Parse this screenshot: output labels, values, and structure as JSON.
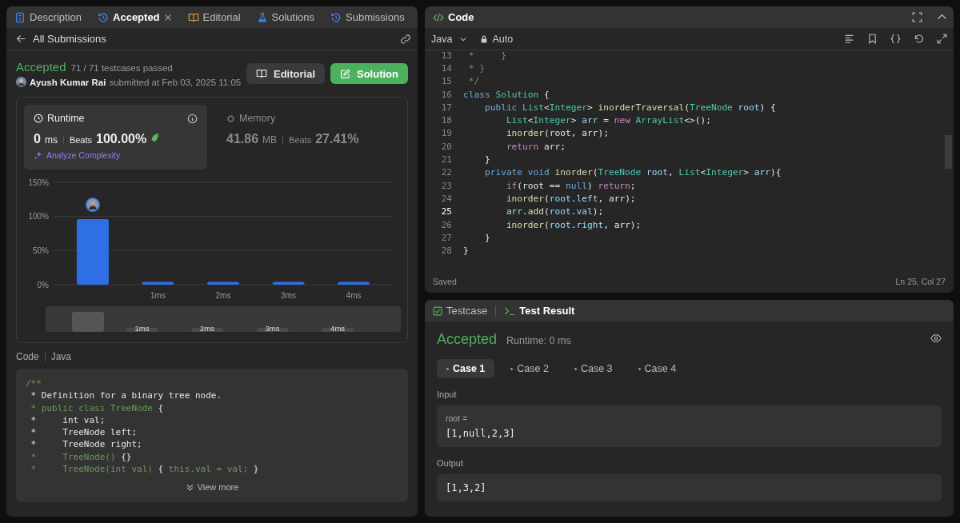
{
  "tabs": [
    {
      "label": "Description",
      "selected": false,
      "closable": false
    },
    {
      "label": "Accepted",
      "selected": true,
      "closable": true
    },
    {
      "label": "Editorial",
      "selected": false,
      "closable": false
    },
    {
      "label": "Solutions",
      "selected": false,
      "closable": false
    },
    {
      "label": "Submissions",
      "selected": false,
      "closable": false
    }
  ],
  "back_link": "All Submissions",
  "submission": {
    "status": "Accepted",
    "testcases": "71 / 71 testcases passed",
    "author": "Ayush Kumar Rai",
    "submitted": "submitted at Feb 03, 2025 11:05",
    "buttons": [
      {
        "label": "Editorial",
        "kind": "secondary"
      },
      {
        "label": "Solution",
        "kind": "primary"
      }
    ]
  },
  "stats": [
    {
      "title": "Runtime",
      "value": "0",
      "unit": "ms",
      "beats_label": "Beats",
      "beats": "100.00%",
      "selected": true,
      "action": "Analyze Complexity"
    },
    {
      "title": "Memory",
      "value": "41.86",
      "unit": "MB",
      "beats_label": "Beats",
      "beats": "27.41%",
      "selected": false
    }
  ],
  "chart_data": {
    "type": "bar",
    "x": [
      0,
      1,
      2,
      3,
      4
    ],
    "values": [
      96,
      4,
      4,
      4,
      4
    ],
    "xlim": [
      -0.6,
      4.6
    ],
    "ylim": [
      0,
      150
    ],
    "yticks": [
      {
        "value": 0,
        "label": "0%"
      },
      {
        "value": 50,
        "label": "50%"
      },
      {
        "value": 100,
        "label": "100%"
      },
      {
        "value": 150,
        "label": "150%"
      }
    ],
    "xticks": [
      {
        "value": 1,
        "label": "1ms"
      },
      {
        "value": 2,
        "label": "2ms"
      },
      {
        "value": 3,
        "label": "3ms"
      },
      {
        "value": 4,
        "label": "4ms"
      }
    ]
  },
  "navigator": {
    "labels": [
      "1ms",
      "2ms",
      "3ms",
      "4ms"
    ]
  },
  "code_section": {
    "label": "Code",
    "language": "Java",
    "more": "View more",
    "lines": [
      [
        {
          "text": "/**",
          "kind": "comment"
        }
      ],
      [
        {
          "text": " * Definition for a binary tree node.",
          "kind": "plain"
        }
      ],
      [
        {
          "text": " * public class TreeNode ",
          "kind": "comment"
        },
        {
          "text": "{",
          "kind": "plain"
        }
      ],
      [
        {
          "text": " *     int val;",
          "kind": "plain"
        }
      ],
      [
        {
          "text": " *     TreeNode left;",
          "kind": "plain"
        }
      ],
      [
        {
          "text": " *     TreeNode right;",
          "kind": "plain"
        }
      ],
      [
        {
          "text": " *     TreeNode() ",
          "kind": "comment"
        },
        {
          "text": "{}",
          "kind": "plain"
        }
      ],
      [
        {
          "text": " *     TreeNode(int val) ",
          "kind": "comment"
        },
        {
          "text": "{ ",
          "kind": "plain"
        },
        {
          "text": "this.val = val;",
          "kind": "comment"
        },
        {
          "text": " }",
          "kind": "plain"
        }
      ]
    ]
  },
  "editor": {
    "title": "Code",
    "language": "Java",
    "mode": "Auto",
    "status": "Saved",
    "cursor": "Ln 25, Col 27",
    "lines": [
      {
        "number": "13",
        "current": false,
        "tokens": [
          {
            "text": " *     }",
            "kind": "comment"
          }
        ]
      },
      {
        "number": "14",
        "current": false,
        "tokens": [
          {
            "text": " * }",
            "kind": "comment"
          }
        ]
      },
      {
        "number": "15",
        "current": false,
        "tokens": [
          {
            "text": " */",
            "kind": "comment"
          }
        ]
      },
      {
        "number": "16",
        "current": false,
        "tokens": [
          {
            "text": "class ",
            "kind": "keyword"
          },
          {
            "text": "Solution",
            "kind": "type"
          },
          {
            "text": " {",
            "kind": "plain"
          }
        ]
      },
      {
        "number": "17",
        "current": false,
        "tokens": [
          {
            "text": "    public ",
            "kind": "keyword"
          },
          {
            "text": "List",
            "kind": "type"
          },
          {
            "text": "<",
            "kind": "plain"
          },
          {
            "text": "Integer",
            "kind": "type"
          },
          {
            "text": "> ",
            "kind": "plain"
          },
          {
            "text": "inorderTraversal",
            "kind": "function"
          },
          {
            "text": "(",
            "kind": "plain"
          },
          {
            "text": "TreeNode ",
            "kind": "type"
          },
          {
            "text": "root",
            "kind": "variable"
          },
          {
            "text": ") {",
            "kind": "plain"
          }
        ]
      },
      {
        "number": "18",
        "current": false,
        "tokens": [
          {
            "text": "        List",
            "kind": "type"
          },
          {
            "text": "<",
            "kind": "plain"
          },
          {
            "text": "Integer",
            "kind": "type"
          },
          {
            "text": "> ",
            "kind": "plain"
          },
          {
            "text": "arr",
            "kind": "variable"
          },
          {
            "text": " = ",
            "kind": "plain"
          },
          {
            "text": "new ",
            "kind": "control"
          },
          {
            "text": "ArrayList",
            "kind": "type"
          },
          {
            "text": "<>();",
            "kind": "plain"
          }
        ]
      },
      {
        "number": "19",
        "current": false,
        "tokens": [
          {
            "text": "        inorder",
            "kind": "function"
          },
          {
            "text": "(root, arr);",
            "kind": "plain"
          }
        ]
      },
      {
        "number": "20",
        "current": false,
        "tokens": [
          {
            "text": "        return",
            "kind": "control"
          },
          {
            "text": " arr;",
            "kind": "plain"
          }
        ]
      },
      {
        "number": "21",
        "current": false,
        "tokens": [
          {
            "text": "    }",
            "kind": "plain"
          }
        ]
      },
      {
        "number": "22",
        "current": false,
        "tokens": [
          {
            "text": "    private ",
            "kind": "keyword"
          },
          {
            "text": "void ",
            "kind": "keyword"
          },
          {
            "text": "inorder",
            "kind": "function"
          },
          {
            "text": "(",
            "kind": "plain"
          },
          {
            "text": "TreeNode ",
            "kind": "type"
          },
          {
            "text": "root",
            "kind": "variable"
          },
          {
            "text": ", ",
            "kind": "plain"
          },
          {
            "text": "List",
            "kind": "type"
          },
          {
            "text": "<",
            "kind": "plain"
          },
          {
            "text": "Integer",
            "kind": "type"
          },
          {
            "text": "> ",
            "kind": "plain"
          },
          {
            "text": "arr",
            "kind": "variable"
          },
          {
            "text": "){",
            "kind": "plain"
          }
        ]
      },
      {
        "number": "23",
        "current": false,
        "tokens": [
          {
            "text": "        if",
            "kind": "control"
          },
          {
            "text": "(root == ",
            "kind": "plain"
          },
          {
            "text": "null",
            "kind": "keyword"
          },
          {
            "text": ") ",
            "kind": "plain"
          },
          {
            "text": "return",
            "kind": "control"
          },
          {
            "text": ";",
            "kind": "plain"
          }
        ]
      },
      {
        "number": "24",
        "current": false,
        "tokens": [
          {
            "text": "        inorder",
            "kind": "function"
          },
          {
            "text": "(",
            "kind": "plain"
          },
          {
            "text": "root",
            "kind": "variable"
          },
          {
            "text": ".",
            "kind": "plain"
          },
          {
            "text": "left",
            "kind": "variable"
          },
          {
            "text": ", arr);",
            "kind": "plain"
          }
        ]
      },
      {
        "number": "25",
        "current": true,
        "tokens": [
          {
            "text": "        arr",
            "kind": "variable"
          },
          {
            "text": ".",
            "kind": "plain"
          },
          {
            "text": "add",
            "kind": "function"
          },
          {
            "text": "(",
            "kind": "plain"
          },
          {
            "text": "root",
            "kind": "variable"
          },
          {
            "text": ".",
            "kind": "plain"
          },
          {
            "text": "val",
            "kind": "variable"
          },
          {
            "text": ");",
            "kind": "plain"
          }
        ]
      },
      {
        "number": "26",
        "current": false,
        "tokens": [
          {
            "text": "        inorder",
            "kind": "function"
          },
          {
            "text": "(",
            "kind": "plain"
          },
          {
            "text": "root",
            "kind": "variable"
          },
          {
            "text": ".",
            "kind": "plain"
          },
          {
            "text": "right",
            "kind": "variable"
          },
          {
            "text": ", arr);",
            "kind": "plain"
          }
        ]
      },
      {
        "number": "27",
        "current": false,
        "tokens": [
          {
            "text": "    }",
            "kind": "plain"
          }
        ]
      },
      {
        "number": "28",
        "current": false,
        "tokens": [
          {
            "text": "}",
            "kind": "plain"
          }
        ]
      }
    ]
  },
  "result_tabs": [
    {
      "label": "Testcase",
      "selected": false
    },
    {
      "label": "Test Result",
      "selected": true
    }
  ],
  "result": {
    "status": "Accepted",
    "runtime": "Runtime: 0 ms",
    "cases": [
      {
        "label": "Case 1",
        "selected": true,
        "passed": true
      },
      {
        "label": "Case 2",
        "selected": false,
        "passed": true
      },
      {
        "label": "Case 3",
        "selected": false,
        "passed": true
      },
      {
        "label": "Case 4",
        "selected": false,
        "passed": true
      }
    ],
    "sections": [
      {
        "label": "Input",
        "name": "root =",
        "value": "[1,null,2,3]"
      },
      {
        "label": "Output",
        "value": "[1,3,2]"
      }
    ]
  }
}
